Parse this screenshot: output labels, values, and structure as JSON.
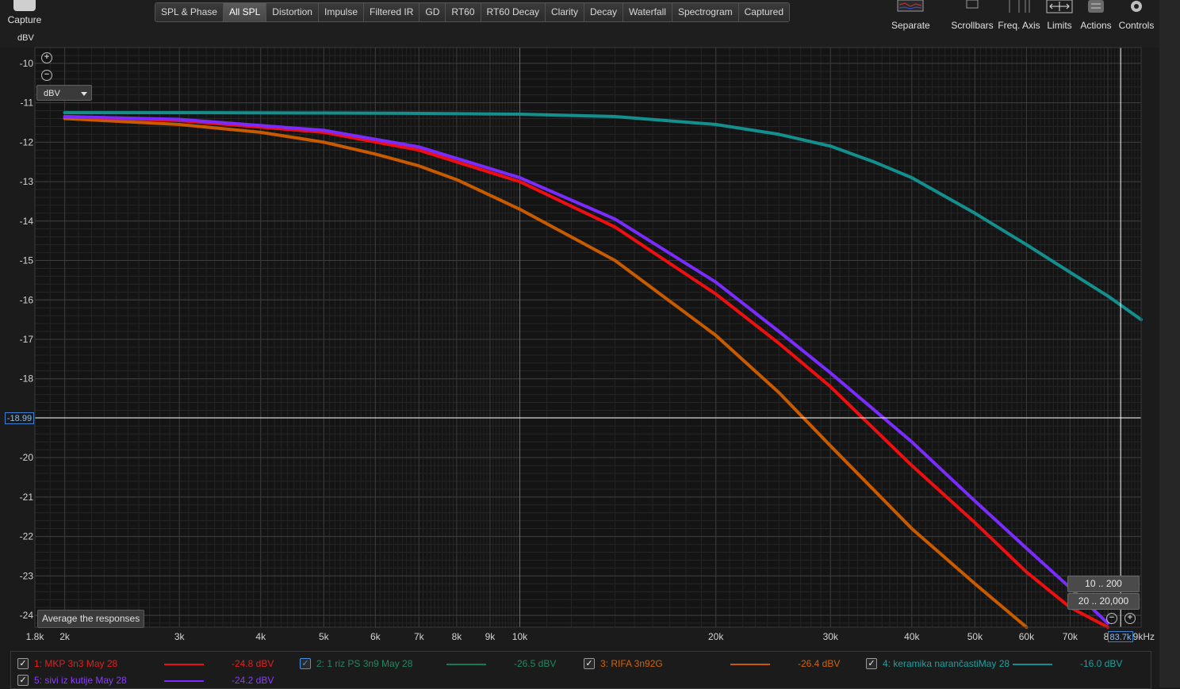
{
  "capture": {
    "label": "Capture"
  },
  "tabs": [
    "SPL & Phase",
    "All SPL",
    "Distortion",
    "Impulse",
    "Filtered IR",
    "GD",
    "RT60",
    "RT60 Decay",
    "Clarity",
    "Decay",
    "Waterfall",
    "Spectrogram",
    "Captured"
  ],
  "active_tab": "All SPL",
  "toolbar": {
    "separate": "Separate",
    "scrollbars": "Scrollbars",
    "freq_axis": "Freq. Axis",
    "limits": "Limits",
    "actions": "Actions",
    "controls": "Controls"
  },
  "y_unit": "dBV",
  "unit_select": "dBV",
  "cursor": {
    "y_value": "-18.99",
    "x_value": "83.7k"
  },
  "range_buttons": [
    "10 .. 200",
    "20 .. 20,000"
  ],
  "average_button": "Average the responses",
  "chart_data": {
    "type": "line",
    "xscale": "log",
    "xlim": [
      1800,
      90000
    ],
    "ylim": [
      -24.3,
      -9.6
    ],
    "xunit": "kHz",
    "ylabel": "dBV",
    "grid": true,
    "yticks": [
      -10,
      -11,
      -12,
      -13,
      -14,
      -15,
      -16,
      -17,
      -18,
      -20,
      -21,
      -22,
      -23,
      -24
    ],
    "xticks": [
      {
        "v": 1800,
        "label": "1.8k"
      },
      {
        "v": 2000,
        "label": "2k"
      },
      {
        "v": 3000,
        "label": "3k"
      },
      {
        "v": 4000,
        "label": "4k"
      },
      {
        "v": 5000,
        "label": "5k"
      },
      {
        "v": 6000,
        "label": "6k"
      },
      {
        "v": 7000,
        "label": "7k"
      },
      {
        "v": 8000,
        "label": "8k"
      },
      {
        "v": 9000,
        "label": "9k"
      },
      {
        "v": 10000,
        "label": "10k"
      },
      {
        "v": 20000,
        "label": "20k"
      },
      {
        "v": 30000,
        "label": "30k"
      },
      {
        "v": 40000,
        "label": "40k"
      },
      {
        "v": 50000,
        "label": "50k"
      },
      {
        "v": 60000,
        "label": "60k"
      },
      {
        "v": 70000,
        "label": "70k"
      },
      {
        "v": 80000,
        "label": "8("
      }
    ],
    "x_end_label": "9kHz",
    "series": [
      {
        "name": "4: keramika narančastiMay 28",
        "color": "#13908e",
        "x": [
          2000,
          3000,
          5000,
          7000,
          10000,
          14000,
          20000,
          25000,
          30000,
          35000,
          40000,
          50000,
          60000,
          70000,
          80000,
          90000
        ],
        "y": [
          -11.25,
          -11.25,
          -11.26,
          -11.27,
          -11.29,
          -11.35,
          -11.55,
          -11.8,
          -12.1,
          -12.5,
          -12.9,
          -13.8,
          -14.6,
          -15.3,
          -15.9,
          -16.5
        ]
      },
      {
        "name": "3: RIFA 3n92G",
        "color": "#c85a00",
        "x": [
          2000,
          3000,
          4000,
          5000,
          6000,
          7000,
          8000,
          10000,
          14000,
          20000,
          25000,
          30000,
          40000,
          50000,
          60000
        ],
        "y": [
          -11.4,
          -11.55,
          -11.75,
          -12.0,
          -12.3,
          -12.6,
          -12.95,
          -13.7,
          -15.0,
          -16.9,
          -18.35,
          -19.7,
          -21.8,
          -23.2,
          -24.3
        ]
      },
      {
        "name": "1: MKP 3n3 May 28",
        "color": "#ee1010",
        "x": [
          2000,
          3000,
          5000,
          7000,
          10000,
          14000,
          20000,
          25000,
          30000,
          40000,
          50000,
          60000,
          70000,
          80000
        ],
        "y": [
          -11.35,
          -11.45,
          -11.75,
          -12.2,
          -13.0,
          -14.15,
          -15.85,
          -17.1,
          -18.2,
          -20.2,
          -21.65,
          -22.9,
          -23.8,
          -24.3
        ]
      },
      {
        "name": "5: sivi iz kutije May 28",
        "color": "#7a2cff",
        "x": [
          2000,
          3000,
          5000,
          7000,
          10000,
          14000,
          20000,
          25000,
          30000,
          40000,
          50000,
          60000,
          70000,
          80000
        ],
        "y": [
          -11.35,
          -11.42,
          -11.7,
          -12.12,
          -12.9,
          -13.95,
          -15.55,
          -16.8,
          -17.85,
          -19.6,
          -21.1,
          -22.3,
          -23.3,
          -24.2
        ]
      }
    ]
  },
  "legend": [
    {
      "label": "1: MKP 3n3 May 28",
      "value": "-24.8 dBV",
      "color": "#ee1010",
      "checked": true,
      "text_color": "#e02020"
    },
    {
      "label": "2: 1 riz PS 3n9 May 28",
      "value": "-26.5 dBV",
      "color": "#167a55",
      "checked": true,
      "text_color": "#1f8a60"
    },
    {
      "label": "3: RIFA 3n92G",
      "value": "-26.4 dBV",
      "color": "#c85a00",
      "checked": true,
      "text_color": "#d0650a"
    },
    {
      "label": "4: keramika narančastiMay 28",
      "value": "-16.0 dBV",
      "color": "#13908e",
      "checked": true,
      "text_color": "#1aa3a0"
    },
    {
      "label": "5: sivi iz kutije May 28",
      "value": "-24.2 dBV",
      "color": "#7a2cff",
      "checked": true,
      "text_color": "#8a3cff"
    }
  ]
}
